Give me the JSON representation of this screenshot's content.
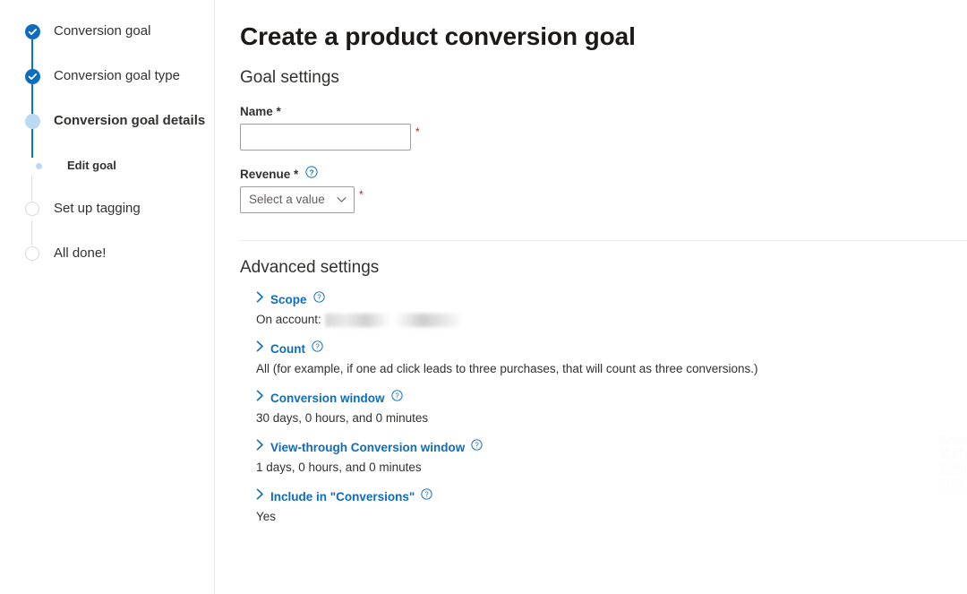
{
  "wizard": {
    "steps": [
      {
        "label": "Conversion goal",
        "state": "done"
      },
      {
        "label": "Conversion goal type",
        "state": "done"
      },
      {
        "label": "Conversion goal details",
        "state": "current"
      },
      {
        "label": "Edit goal",
        "state": "substep"
      },
      {
        "label": "Set up tagging",
        "state": "todo"
      },
      {
        "label": "All done!",
        "state": "todo"
      }
    ]
  },
  "main": {
    "page_title": "Create a product conversion goal",
    "goal_settings": {
      "heading": "Goal settings",
      "name": {
        "label": "Name *",
        "value": "",
        "placeholder": "",
        "required_marker": "*"
      },
      "revenue": {
        "label": "Revenue *",
        "help_icon": "question-circle-icon",
        "selected": "Select a value",
        "required_marker": "*"
      }
    },
    "advanced_settings": {
      "heading": "Advanced settings",
      "items": [
        {
          "title": "Scope",
          "help_icon": "question-circle-icon",
          "expand_icon": "chevron-right-icon",
          "value_prefix": "On account:",
          "value": "",
          "redacted": true
        },
        {
          "title": "Count",
          "help_icon": "question-circle-icon",
          "expand_icon": "chevron-right-icon",
          "value_prefix": "",
          "value": "All (for example, if one ad click leads to three purchases, that will count as three conversions.)",
          "redacted": false
        },
        {
          "title": "Conversion window",
          "help_icon": "question-circle-icon",
          "expand_icon": "chevron-right-icon",
          "value_prefix": "",
          "value": "30 days, 0 hours, and 0 minutes",
          "redacted": false
        },
        {
          "title": "View-through Conversion window",
          "help_icon": "question-circle-icon",
          "expand_icon": "chevron-right-icon",
          "value_prefix": "",
          "value": "1 days, 0 hours, and 0 minutes",
          "redacted": false
        },
        {
          "title": "Include in \"Conversions\"",
          "help_icon": "question-circle-icon",
          "expand_icon": "chevron-right-icon",
          "value_prefix": "",
          "value": "Yes",
          "redacted": false
        }
      ]
    }
  },
  "watermark": {
    "lines": [
      "Snipa",
      "截屏t",
      "贴图t",
      "贴图:"
    ]
  },
  "colors": {
    "accent_blue": "#0f6cbd",
    "link_blue": "#0f6cbd",
    "step_done": "#0f6cbd",
    "step_current": "#bcd9f2",
    "step_todo_border": "#d9d9d9",
    "required_red": "#a4262c",
    "text_primary": "#323130",
    "text_secondary": "#605e5c",
    "border_gray": "#a19f9d",
    "divider_gray": "#ededed"
  }
}
